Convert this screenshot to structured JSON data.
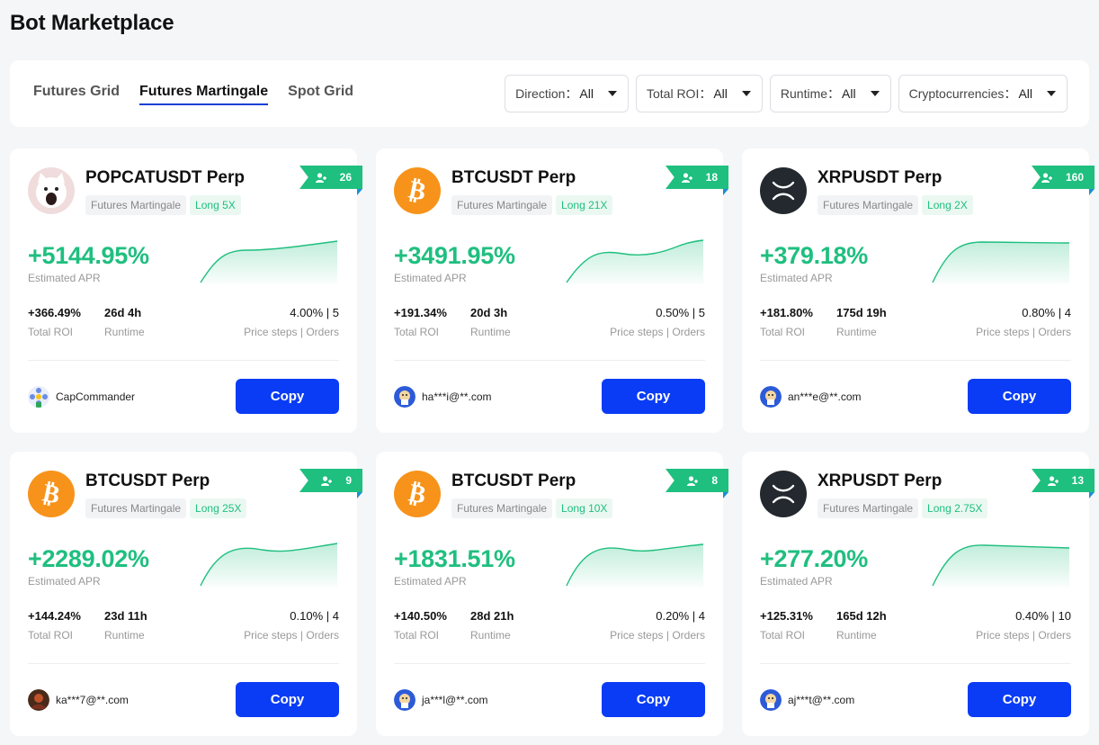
{
  "page": {
    "title": "Bot Marketplace"
  },
  "tabs": [
    {
      "label": "Futures Grid"
    },
    {
      "label": "Futures Martingale",
      "active": true
    },
    {
      "label": "Spot Grid"
    }
  ],
  "filters": [
    {
      "label": "Direction：",
      "value": "All"
    },
    {
      "label": "Total ROI：",
      "value": "All"
    },
    {
      "label": "Runtime：",
      "value": "All"
    },
    {
      "label": "Cryptocurrencies：",
      "value": "All"
    }
  ],
  "colors": {
    "accent_green": "#1fbf7f",
    "button_blue": "#0a3cf5"
  },
  "cards": [
    {
      "icon": "popcat-icon",
      "pair": "POPCATUSDT Perp",
      "type_tag": "Futures Martingale",
      "leverage_tag": "Long 5X",
      "copiers": "26",
      "apr": "+5144.95%",
      "apr_label": "Estimated APR",
      "roi": "+366.49%",
      "roi_label": "Total ROI",
      "runtime": "26d 4h",
      "runtime_label": "Runtime",
      "steps": "4.00% | 5",
      "steps_label": "Price steps | Orders",
      "user": "CapCommander",
      "avatar": "flower-avatar",
      "copy_label": "Copy"
    },
    {
      "icon": "bitcoin-icon",
      "pair": "BTCUSDT Perp",
      "type_tag": "Futures Martingale",
      "leverage_tag": "Long 21X",
      "copiers": "18",
      "apr": "+3491.95%",
      "apr_label": "Estimated APR",
      "roi": "+191.34%",
      "roi_label": "Total ROI",
      "runtime": "20d 3h",
      "runtime_label": "Runtime",
      "steps": "0.50% | 5",
      "steps_label": "Price steps | Orders",
      "user": "ha***i@**.com",
      "avatar": "default-avatar",
      "copy_label": "Copy"
    },
    {
      "icon": "xrp-icon",
      "pair": "XRPUSDT Perp",
      "type_tag": "Futures Martingale",
      "leverage_tag": "Long 2X",
      "copiers": "160",
      "apr": "+379.18%",
      "apr_label": "Estimated APR",
      "roi": "+181.80%",
      "roi_label": "Total ROI",
      "runtime": "175d 19h",
      "runtime_label": "Runtime",
      "steps": "0.80% | 4",
      "steps_label": "Price steps | Orders",
      "user": "an***e@**.com",
      "avatar": "default-avatar",
      "copy_label": "Copy"
    },
    {
      "icon": "bitcoin-icon",
      "pair": "BTCUSDT Perp",
      "type_tag": "Futures Martingale",
      "leverage_tag": "Long 25X",
      "copiers": "9",
      "apr": "+2289.02%",
      "apr_label": "Estimated APR",
      "roi": "+144.24%",
      "roi_label": "Total ROI",
      "runtime": "23d 11h",
      "runtime_label": "Runtime",
      "steps": "0.10% | 4",
      "steps_label": "Price steps | Orders",
      "user": "ka***7@**.com",
      "avatar": "photo-avatar",
      "copy_label": "Copy"
    },
    {
      "icon": "bitcoin-icon",
      "pair": "BTCUSDT Perp",
      "type_tag": "Futures Martingale",
      "leverage_tag": "Long 10X",
      "copiers": "8",
      "apr": "+1831.51%",
      "apr_label": "Estimated APR",
      "roi": "+140.50%",
      "roi_label": "Total ROI",
      "runtime": "28d 21h",
      "runtime_label": "Runtime",
      "steps": "0.20% | 4",
      "steps_label": "Price steps | Orders",
      "user": "ja***l@**.com",
      "avatar": "default-avatar",
      "copy_label": "Copy"
    },
    {
      "icon": "xrp-icon",
      "pair": "XRPUSDT Perp",
      "type_tag": "Futures Martingale",
      "leverage_tag": "Long 2.75X",
      "copiers": "13",
      "apr": "+277.20%",
      "apr_label": "Estimated APR",
      "roi": "+125.31%",
      "roi_label": "Total ROI",
      "runtime": "165d 12h",
      "runtime_label": "Runtime",
      "steps": "0.40% | 10",
      "steps_label": "Price steps | Orders",
      "user": "aj***t@**.com",
      "avatar": "default-avatar",
      "copy_label": "Copy"
    }
  ]
}
